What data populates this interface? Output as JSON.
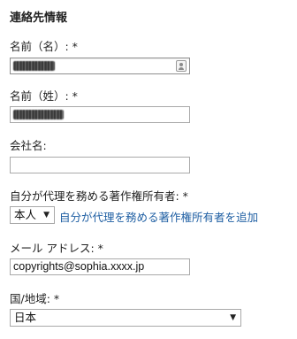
{
  "section_title": "連絡先情報",
  "fields": {
    "first_name": {
      "label": "名前（名）: *",
      "value": ""
    },
    "last_name": {
      "label": "名前（姓）: *",
      "value": ""
    },
    "company": {
      "label": "会社名:",
      "value": ""
    },
    "agent": {
      "label": "自分が代理を務める著作権所有者: *",
      "selected": "本人",
      "add_link": "自分が代理を務める著作権所有者を追加"
    },
    "email": {
      "label": "メール アドレス: *",
      "value": "copyrights@sophia.xxxx.jp"
    },
    "country": {
      "label": "国/地域: *",
      "selected": "日本"
    }
  },
  "icons": {
    "contact_card": "contact-card-icon",
    "dropdown": "dropdown-arrow-icon"
  }
}
